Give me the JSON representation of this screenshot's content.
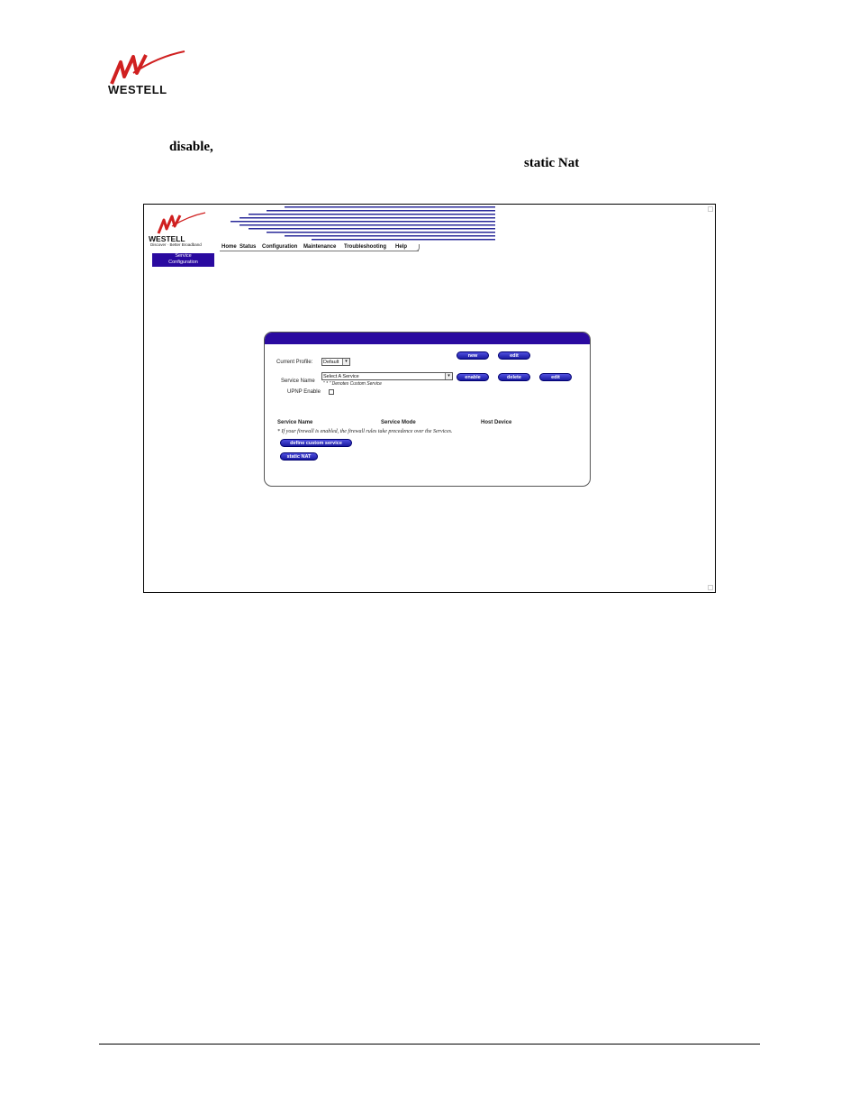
{
  "document": {
    "brand": "WESTELL",
    "bold_word_1": "disable,",
    "bold_word_2": "static Nat"
  },
  "screenshot": {
    "logo": {
      "brand": "WESTELL",
      "tagline": "Discover · Better Broadband"
    },
    "nav": [
      "Home",
      "Status",
      "Configuration",
      "Maintenance",
      "Troubleshooting",
      "Help"
    ],
    "side_tab": {
      "line1": "Service",
      "line2": "Configuration"
    },
    "form": {
      "current_profile_label": "Current Profile:",
      "current_profile_value": "Default",
      "service_name_label": "Service Name",
      "service_name_value": "Select A Service",
      "custom_note": "\" * \" Denotes Custom Service",
      "upnp_label": "UPNP Enable",
      "buttons": {
        "new": "new",
        "edit_profile": "edit",
        "enable": "enable",
        "delete": "delete",
        "edit_service": "edit",
        "define_custom": "define custom service",
        "static_nat": "static NAT"
      },
      "table_headers": [
        "Service Name",
        "Service Mode",
        "Host Device"
      ],
      "firewall_note": "* If your firewall is enabled, the firewall rules take precedence over the Services."
    }
  }
}
